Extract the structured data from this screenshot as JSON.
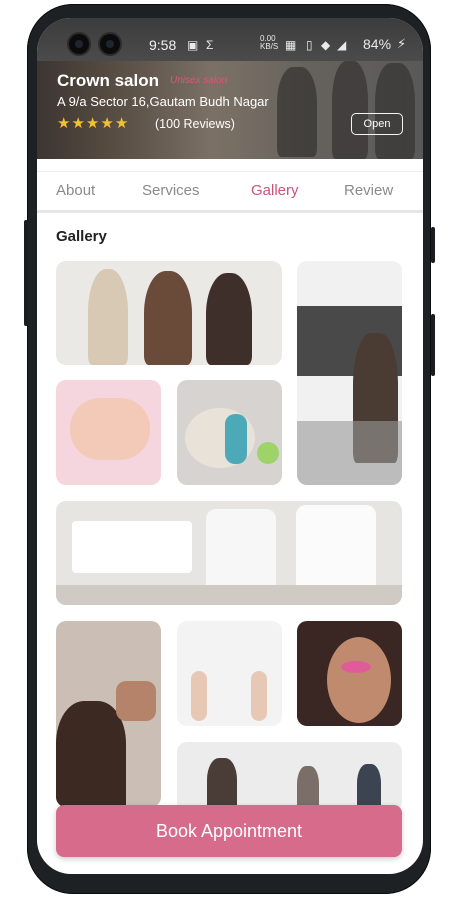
{
  "status_bar": {
    "time": "9:58",
    "speed": "0.00\nKB/S",
    "battery": "84%"
  },
  "salon": {
    "name": "Crown salon",
    "tagline": "Unisex salon",
    "address": "A 9/a Sector 16,Gautam Budh Nagar",
    "rating_stars": 5,
    "reviews": "(100 Reviews)",
    "open_label": "Open"
  },
  "tabs": [
    {
      "label": "About",
      "active": false
    },
    {
      "label": "Services",
      "active": false
    },
    {
      "label": "Gallery",
      "active": true
    },
    {
      "label": "Review",
      "active": false
    }
  ],
  "gallery": {
    "title": "Gallery",
    "images": [
      "stylists-team-photo",
      "salon-interior-with-client",
      "manicure-hands",
      "facial-mask-treatment",
      "pedicure-station",
      "hair-styling",
      "hair-tools-hands",
      "makeup-application",
      "salon-floor-people"
    ]
  },
  "cta": {
    "label": "Book Appointment"
  },
  "colors": {
    "accent": "#d66b8c",
    "active_tab": "#c9547a",
    "star": "#f2c230"
  }
}
